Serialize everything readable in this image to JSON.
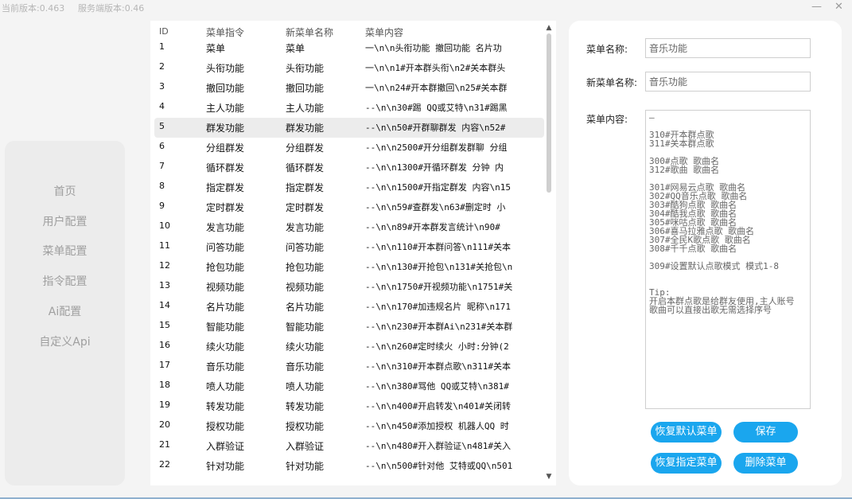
{
  "versions": {
    "current": "当前版本:0.463",
    "server": "服务端版本:0.46"
  },
  "window_controls": {
    "minimize": "—",
    "close": "✕"
  },
  "sidebar": {
    "items": [
      {
        "label": "首页"
      },
      {
        "label": "用户配置"
      },
      {
        "label": "菜单配置"
      },
      {
        "label": "指令配置"
      },
      {
        "label": "Ai配置"
      },
      {
        "label": "自定义Api"
      }
    ]
  },
  "table": {
    "headers": {
      "id": "ID",
      "cmd": "菜单指令",
      "name": "新菜单名称",
      "content": "菜单内容"
    },
    "selected_id": "5",
    "rows": [
      {
        "id": "1",
        "cmd": "菜单",
        "name": "菜单",
        "content": "一\\n\\n头衔功能 撤回功能 名片功"
      },
      {
        "id": "2",
        "cmd": "头衔功能",
        "name": "头衔功能",
        "content": "一\\n\\n1#开本群头衔\\n2#关本群头"
      },
      {
        "id": "3",
        "cmd": "撤回功能",
        "name": "撤回功能",
        "content": "一\\n\\n24#开本群撤回\\n25#关本群"
      },
      {
        "id": "4",
        "cmd": "主人功能",
        "name": "主人功能",
        "content": "--\\n\\n30#踢 QQ或艾特\\n31#踢黑"
      },
      {
        "id": "5",
        "cmd": "群发功能",
        "name": "群发功能",
        "content": "--\\n\\n50#开群聊群发 内容\\n52#"
      },
      {
        "id": "6",
        "cmd": "分组群发",
        "name": "分组群发",
        "content": "--\\n\\n2500#开分组群发群聊 分组"
      },
      {
        "id": "7",
        "cmd": "循环群发",
        "name": "循环群发",
        "content": "--\\n\\n1300#开循环群发 分钟 内"
      },
      {
        "id": "8",
        "cmd": "指定群发",
        "name": "指定群发",
        "content": "--\\n\\n1500#开指定群发 内容\\n15"
      },
      {
        "id": "9",
        "cmd": "定时群发",
        "name": "定时群发",
        "content": "--\\n\\n59#查群发\\n63#删定时 小"
      },
      {
        "id": "10",
        "cmd": "发言功能",
        "name": "发言功能",
        "content": "--\\n\\n89#开本群发言统计\\n90#"
      },
      {
        "id": "11",
        "cmd": "问答功能",
        "name": "问答功能",
        "content": "--\\n\\n110#开本群问答\\n111#关本"
      },
      {
        "id": "12",
        "cmd": "抢包功能",
        "name": "抢包功能",
        "content": "--\\n\\n130#开抢包\\n131#关抢包\\n"
      },
      {
        "id": "13",
        "cmd": "视频功能",
        "name": "视频功能",
        "content": "--\\n\\n1750#开视频功能\\n1751#关"
      },
      {
        "id": "14",
        "cmd": "名片功能",
        "name": "名片功能",
        "content": "--\\n\\n170#加违规名片 昵称\\n171"
      },
      {
        "id": "15",
        "cmd": "智能功能",
        "name": "智能功能",
        "content": "--\\n\\n230#开本群Ai\\n231#关本群"
      },
      {
        "id": "16",
        "cmd": "续火功能",
        "name": "续火功能",
        "content": "--\\n\\n260#定时续火 小时:分钟(2"
      },
      {
        "id": "17",
        "cmd": "音乐功能",
        "name": "音乐功能",
        "content": "--\\n\\n310#开本群点歌\\n311#关本"
      },
      {
        "id": "18",
        "cmd": "喷人功能",
        "name": "喷人功能",
        "content": "--\\n\\n380#骂他 QQ或艾特\\n381#"
      },
      {
        "id": "19",
        "cmd": "转发功能",
        "name": "转发功能",
        "content": "--\\n\\n400#开启转发\\n401#关闭转"
      },
      {
        "id": "20",
        "cmd": "授权功能",
        "name": "授权功能",
        "content": "--\\n\\n450#添加授权 机器人QQ 时"
      },
      {
        "id": "21",
        "cmd": "入群验证",
        "name": "入群验证",
        "content": "--\\n\\n480#开入群验证\\n481#关入"
      },
      {
        "id": "22",
        "cmd": "针对功能",
        "name": "针对功能",
        "content": "--\\n\\n500#针对他 艾特或QQ\\n501"
      }
    ]
  },
  "scrollbar": {
    "up": "▲",
    "down": "▼"
  },
  "editor": {
    "name_label": "菜单名称:",
    "name_value": "音乐功能",
    "newname_label": "新菜单名称:",
    "newname_value": "音乐功能",
    "content_label": "菜单内容:",
    "content_value": "—\n\n310#开本群点歌\n311#关本群点歌\n\n300#点歌 歌曲名\n312#歌曲 歌曲名\n\n301#网易云点歌 歌曲名\n302#QQ音乐点歌 歌曲名\n303#酷狗点歌 歌曲名\n304#酷我点歌 歌曲名\n305#咪咕点歌 歌曲名\n306#喜马拉雅点歌 歌曲名\n307#全民K歌点歌 歌曲名\n308#千千点歌 歌曲名\n\n309#设置默认点歌模式 模式1-8\n\n\nTip:\n开启本群点歌是给群友使用,主人账号\n歌曲可以直接出歌无需选择序号"
  },
  "buttons": {
    "restore_default": "恢复默认菜单",
    "save": "保存",
    "restore_specified": "恢复指定菜单",
    "delete": "删除菜单"
  }
}
